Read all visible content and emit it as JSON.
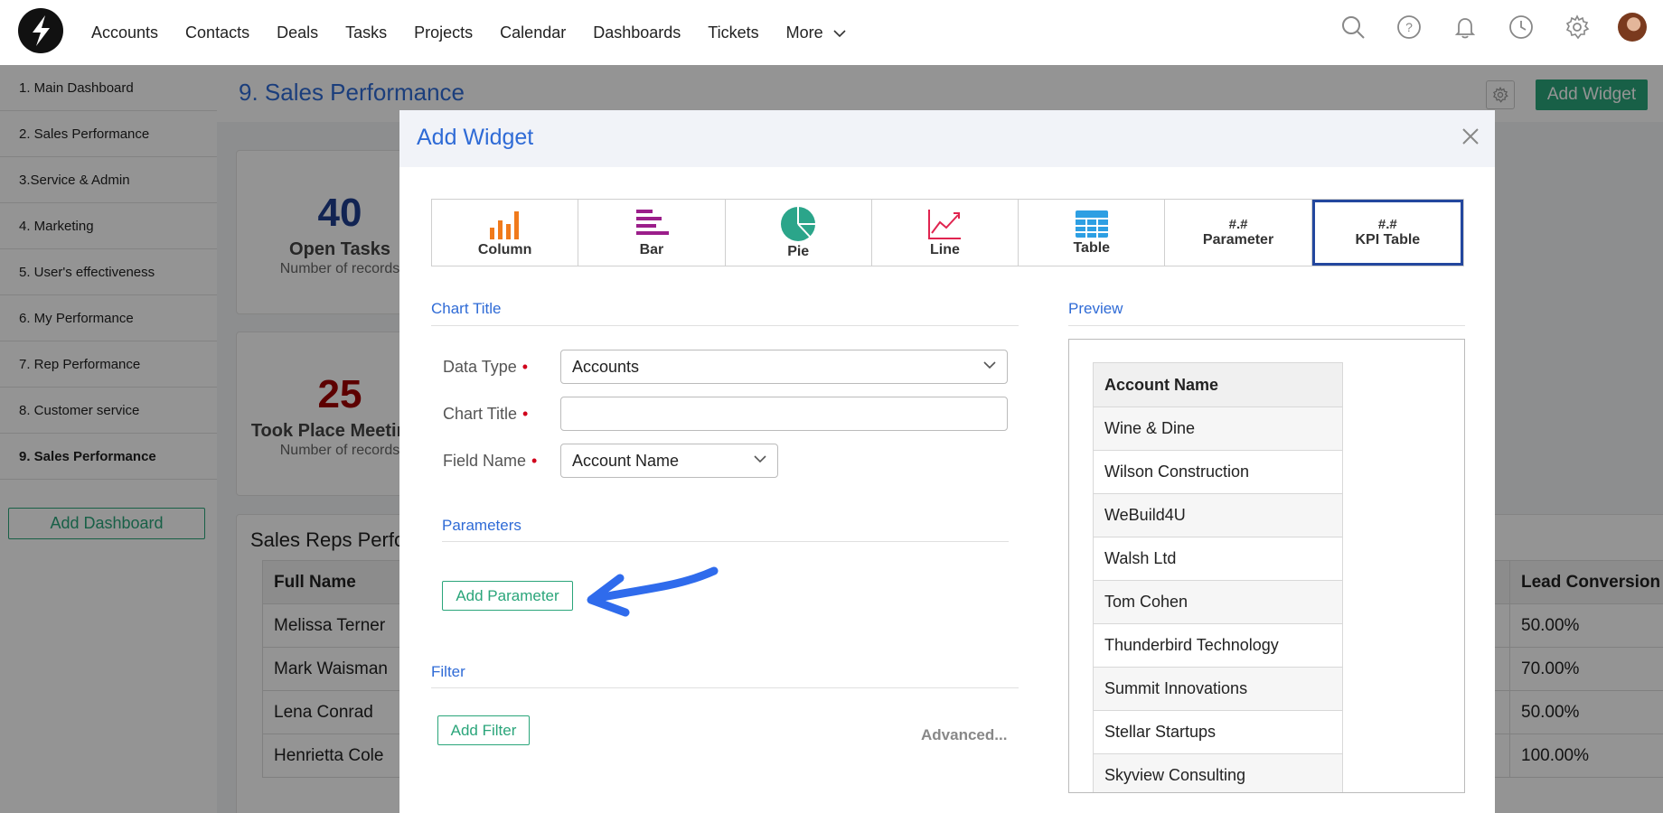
{
  "nav": {
    "items": [
      "Accounts",
      "Contacts",
      "Deals",
      "Tasks",
      "Projects",
      "Calendar",
      "Dashboards",
      "Tickets",
      "More"
    ],
    "icons": [
      "search-icon",
      "help-icon",
      "bell-icon",
      "clock-icon",
      "gear-icon"
    ]
  },
  "sidebar": {
    "items": [
      {
        "label": "1. Main Dashboard"
      },
      {
        "label": "2. Sales Performance"
      },
      {
        "label": "3.Service & Admin"
      },
      {
        "label": "4. Marketing"
      },
      {
        "label": "5. User's effectiveness"
      },
      {
        "label": "6. My Performance"
      },
      {
        "label": "7. Rep Performance"
      },
      {
        "label": "8. Customer service"
      },
      {
        "label": "9. Sales Performance",
        "active": true
      }
    ],
    "add_dashboard_label": "Add Dashboard"
  },
  "main": {
    "title": "9. Sales Performance",
    "add_widget_label": "Add Widget",
    "kpis": [
      {
        "value": "40",
        "label": "Open Tasks",
        "sub": "Number of records",
        "color": "#1f3f8f"
      },
      {
        "value": "25",
        "label": "Took Place Meetings",
        "sub": "Number of records",
        "color": "#a00000"
      }
    ],
    "reps": {
      "title": "Sales Reps Performance",
      "col_first": "Full Name",
      "col_last": "Lead Conversion",
      "rows": [
        {
          "name": "Melissa Terner",
          "conv": "50.00%"
        },
        {
          "name": "Mark Waisman",
          "conv": "70.00%"
        },
        {
          "name": "Lena Conrad",
          "conv": "50.00%"
        },
        {
          "name": "Henrietta Cole",
          "conv": "100.00%"
        }
      ]
    }
  },
  "modal": {
    "title": "Add Widget",
    "types": [
      {
        "label": "Column",
        "icon": "column-chart-icon",
        "color": "#f07a1c"
      },
      {
        "label": "Bar",
        "icon": "bar-chart-icon",
        "color": "#9b1e8a"
      },
      {
        "label": "Pie",
        "icon": "pie-chart-icon",
        "color": "#2ba58a"
      },
      {
        "label": "Line",
        "icon": "line-chart-icon",
        "color": "#e0244f"
      },
      {
        "label": "Table",
        "icon": "table-icon",
        "color": "#2d9fe3"
      },
      {
        "label": "Parameter",
        "hash": "#.#"
      },
      {
        "label": "KPI Table",
        "hash": "#.#",
        "selected": true
      }
    ],
    "chart_title_section": "Chart Title",
    "preview_section": "Preview",
    "data_type_label": "Data Type",
    "data_type_value": "Accounts",
    "chart_title_label": "Chart Title",
    "chart_title_value": "",
    "field_name_label": "Field Name",
    "field_name_value": "Account Name",
    "parameters_section": "Parameters",
    "add_parameter_label": "Add Parameter",
    "filter_section": "Filter",
    "add_filter_label": "Add Filter",
    "advanced_label": "Advanced...",
    "preview_table": {
      "header": "Account Name",
      "rows": [
        "Wine & Dine",
        "Wilson Construction",
        "WeBuild4U",
        "Walsh Ltd",
        "Tom Cohen",
        "Thunderbird Technology",
        "Summit Innovations",
        "Stellar Startups",
        "Skyview Consulting"
      ]
    }
  },
  "colors": {
    "accent": "#2f6bd6",
    "green": "#2aa57a",
    "annotation_arrow": "#2f6bec"
  }
}
